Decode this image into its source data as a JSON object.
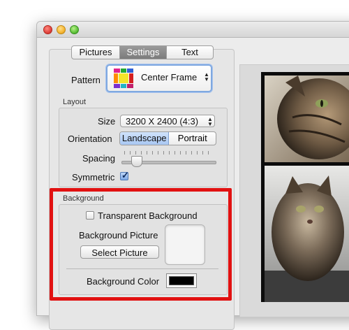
{
  "tabs": [
    {
      "label": "Pictures",
      "active": false
    },
    {
      "label": "Settings",
      "active": true
    },
    {
      "label": "Text",
      "active": false
    }
  ],
  "pattern": {
    "label": "Pattern",
    "value": "Center Frame"
  },
  "layout": {
    "title": "Layout",
    "size_label": "Size",
    "size_value": "3200 X 2400 (4:3)",
    "orientation_label": "Orientation",
    "orientation_options": [
      "Landscape",
      "Portrait"
    ],
    "orientation_selected": "Landscape",
    "spacing_label": "Spacing",
    "spacing_fraction": 0.14,
    "symmetric_label": "Symmetric",
    "symmetric_checked": true
  },
  "background": {
    "title": "Background",
    "transparent_label": "Transparent Background",
    "transparent_checked": false,
    "picture_label": "Background Picture",
    "select_button": "Select Picture",
    "color_label": "Background Color",
    "color_value": "#000000"
  },
  "colors": {
    "highlight": "#e11111",
    "accent": "#7fa8e0"
  },
  "icons": {
    "pattern_thumbnail": "color-grid-icon",
    "popup_arrows": "up-down-arrows-icon",
    "checkmark": "checkmark-icon"
  }
}
